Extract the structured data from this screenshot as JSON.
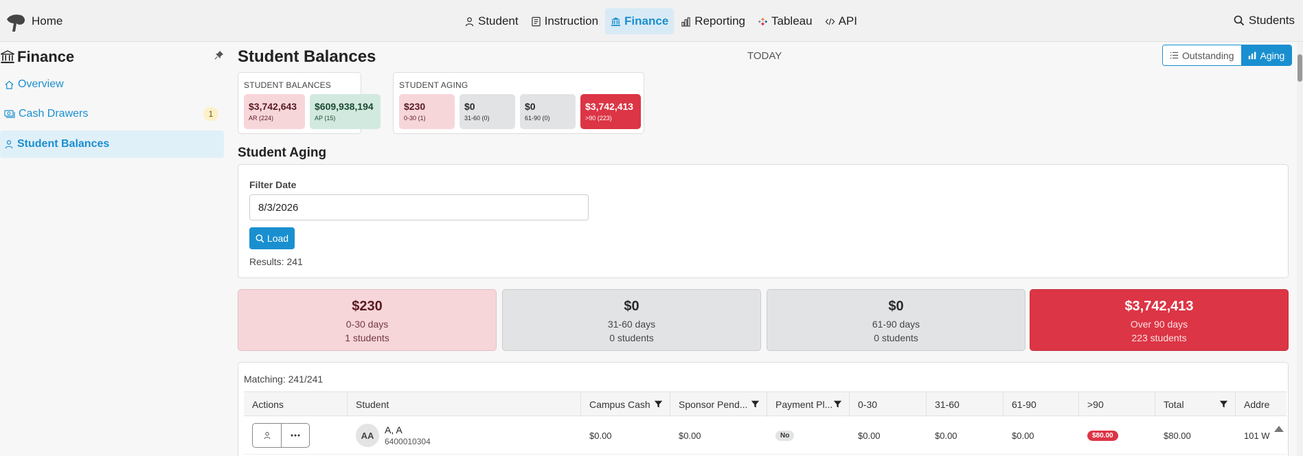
{
  "topnav": {
    "home": "Home",
    "items": [
      {
        "label": "Student",
        "icon": "person-icon"
      },
      {
        "label": "Instruction",
        "icon": "document-icon"
      },
      {
        "label": "Finance",
        "icon": "bank-icon",
        "active": true
      },
      {
        "label": "Reporting",
        "icon": "bar-chart-icon"
      },
      {
        "label": "Tableau",
        "icon": "tableau-icon"
      },
      {
        "label": "API",
        "icon": "code-icon"
      }
    ],
    "search": "Students"
  },
  "sidebar": {
    "title": "Finance",
    "items": [
      {
        "label": "Overview",
        "icon": "home-icon"
      },
      {
        "label": "Cash Drawers",
        "icon": "cash-icon",
        "badge": "1"
      },
      {
        "label": "Student Balances",
        "icon": "person-icon",
        "active": true
      }
    ]
  },
  "main": {
    "title": "Student Balances",
    "today": "TODAY",
    "toggle": {
      "outstanding": "Outstanding",
      "aging": "Aging",
      "selected": "Aging"
    },
    "balances_card": {
      "title": "STUDENT BALANCES",
      "ar": {
        "amount": "$3,742,643",
        "label": "AR (224)"
      },
      "ap": {
        "amount": "$609,938,194",
        "label": "AP (15)"
      }
    },
    "aging_card": {
      "title": "STUDENT AGING",
      "b1": {
        "amount": "$230",
        "label": "0-30 (1)"
      },
      "b2": {
        "amount": "$0",
        "label": "31-60 (0)"
      },
      "b3": {
        "amount": "$0",
        "label": "61-90 (0)"
      },
      "b4": {
        "amount": "$3,742,413",
        "label": ">90 (223)"
      }
    },
    "aging_section": "Student Aging",
    "filter": {
      "label": "Filter Date",
      "value": "8/3/2026",
      "load": "Load",
      "results": "Results: 241"
    },
    "summary": [
      {
        "amount": "$230",
        "range": "0-30 days",
        "count": "1 students"
      },
      {
        "amount": "$0",
        "range": "31-60 days",
        "count": "0 students"
      },
      {
        "amount": "$0",
        "range": "61-90 days",
        "count": "0 students"
      },
      {
        "amount": "$3,742,413",
        "range": "Over 90 days",
        "count": "223 students"
      }
    ],
    "table": {
      "matching": "Matching: 241/241",
      "columns": {
        "actions": "Actions",
        "student": "Student",
        "campus_cash": "Campus Cash",
        "sponsor": "Sponsor Pend...",
        "payment": "Payment Pl...",
        "c0_30": "0-30",
        "c31_60": "31-60",
        "c61_90": "61-90",
        "c90": ">90",
        "total": "Total",
        "address": "Addre"
      },
      "rows": [
        {
          "initials": "AA",
          "name": "A, A",
          "id": "6400010304",
          "campus_cash": "$0.00",
          "sponsor": "$0.00",
          "payment": "No",
          "c0_30": "$0.00",
          "c31_60": "$0.00",
          "c61_90": "$0.00",
          "c90": "$80.00",
          "total": "$80.00",
          "address": "101 W"
        }
      ]
    }
  },
  "colors": {
    "accent": "#1a8fd0",
    "danger": "#dc3545",
    "pink": "#f7d6da",
    "green": "#d2e9df",
    "gray": "#e2e3e5"
  }
}
